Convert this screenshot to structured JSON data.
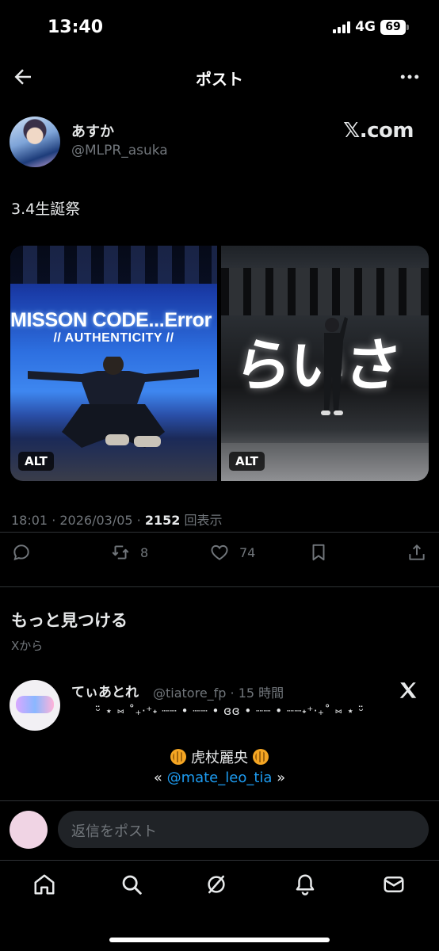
{
  "status_bar": {
    "time": "13:40",
    "network": "4G",
    "battery": "69"
  },
  "header": {
    "title": "ポスト"
  },
  "post": {
    "author_name": "あすか",
    "author_handle": "@MLPR_asuka",
    "watermark": "𝕏.com",
    "text": "3.4生誕祭",
    "media": [
      {
        "alt_label": "ALT",
        "banner_title": "MISSON CODE...Error",
        "banner_subtitle": "// AUTHENTICITY //"
      },
      {
        "alt_label": "ALT",
        "stage_text": "らいさ"
      }
    ],
    "meta": {
      "time_date": "18:01 · 2026/03/05 · ",
      "views": "2152",
      "views_label": " 回表示"
    },
    "actions": {
      "retweets": "8",
      "likes": "74"
    }
  },
  "discover": {
    "title": "もっと見つける",
    "subtitle": "Xから"
  },
  "recommended": {
    "name": "てぃあとれ",
    "handle": "@tiatore_fp · 15 時間",
    "deco": "ᵕ̈  ⋆ ⑅ ˚₊‧⁺˖ ┈┈ • ┈┈ • ɞɞ • ┈┈ • ┈┈˖⁺‧₊˚ ⑅ ⋆ ᵕ̈",
    "line1_text": "虎杖麗央",
    "line2_open": "« ",
    "line2_mention": "@mate_leo_tia",
    "line2_close": " »"
  },
  "reply": {
    "placeholder": "返信をポスト"
  },
  "colors": {
    "background": "#000000",
    "text": "#e7e9ea",
    "muted": "#71767b",
    "link": "#1d9bf0"
  }
}
